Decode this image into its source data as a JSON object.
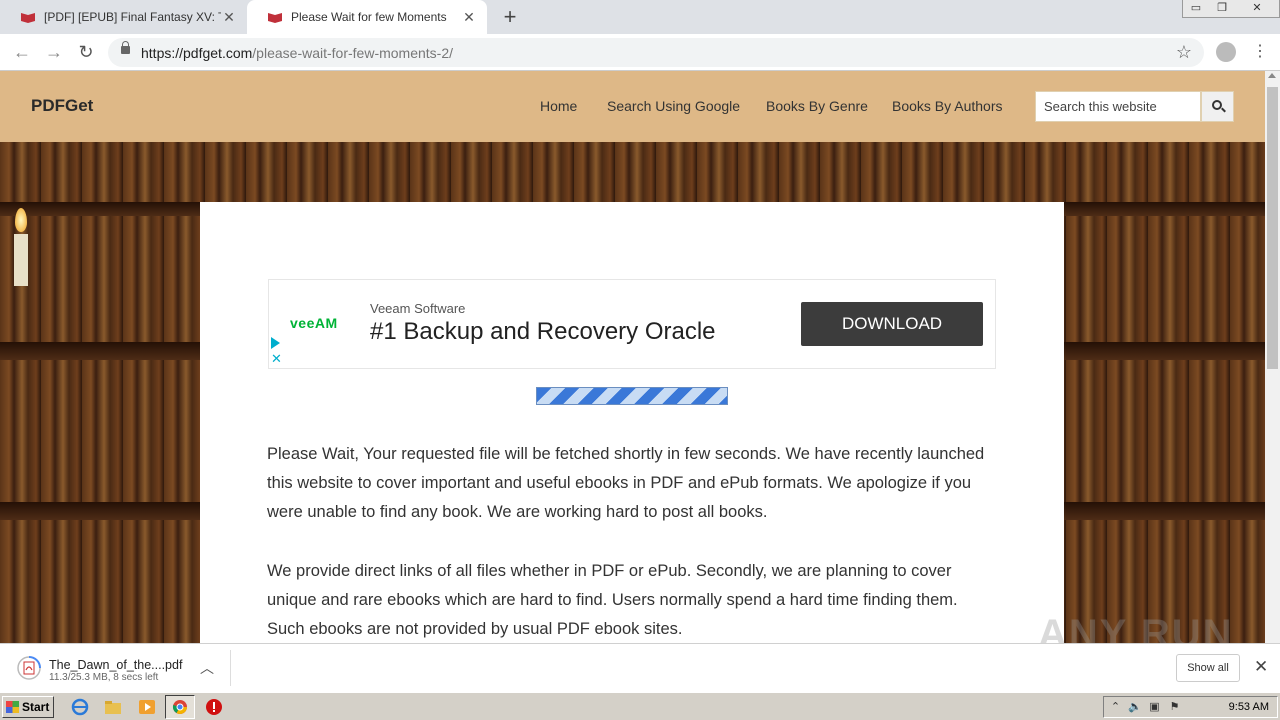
{
  "browser": {
    "tabs": [
      {
        "title": "[PDF] [EPUB] Final Fantasy XV: The Dawn of the Future",
        "active": false
      },
      {
        "title": "Please Wait for few Moments",
        "active": true
      }
    ],
    "new_tab_symbol": "+",
    "window_controls": [
      "minimize",
      "restore",
      "close"
    ],
    "url_host": "https://pdfget.com",
    "url_path": "/please-wait-for-few-moments-2/"
  },
  "site": {
    "logo": "PDFGet",
    "nav": [
      "Home",
      "Search Using Google",
      "Books By Genre",
      "Books By Authors"
    ],
    "search_placeholder": "Search this website"
  },
  "ad": {
    "brand": "veeAM",
    "company": "Veeam Software",
    "headline": "#1 Backup and Recovery Oracle",
    "cta": "DOWNLOAD",
    "colors": {
      "brand": "#00b336",
      "cta_bg": "#3c3c3c",
      "adchoices": "#00aecd"
    }
  },
  "content": {
    "paragraphs": [
      "Please Wait, Your requested file will be fetched shortly in few seconds. We have recently launched this website to cover important and useful ebooks in PDF and ePub formats. We apologize if you were unable to find any book. We are working hard to post all books.",
      "We provide direct links of all files whether in PDF or ePub. Secondly, we are planning to cover unique and rare ebooks which are hard to find. Users normally spend a hard time finding them. Such ebooks are not provided by usual PDF ebook sites."
    ]
  },
  "download": {
    "filename": "The_Dawn_of_the....pdf",
    "progress": "11.3/25.3 MB, 8 secs left",
    "show_all": "Show all"
  },
  "watermark": "ANY RUN",
  "taskbar": {
    "start_label": "Start",
    "clock": "9:53 AM"
  },
  "colors": {
    "header_bg": "#deb887",
    "tab_strip": "#dee1e6"
  }
}
